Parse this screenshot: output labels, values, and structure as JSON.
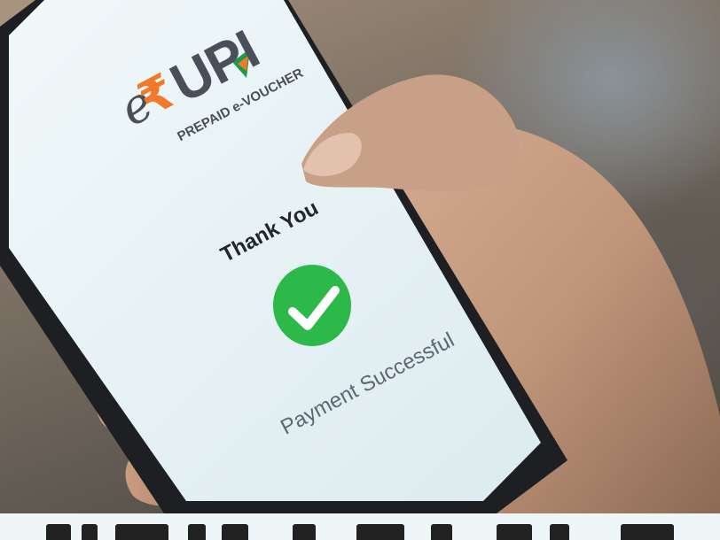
{
  "screen": {
    "logo_prefix": "e",
    "logo_rupee": "₹",
    "logo_main": "UPI",
    "logo_subtitle": "PREPAID e-VOUCHER",
    "heading": "Thank You",
    "status_message": "Payment Successful"
  },
  "colors": {
    "screen_bg": "#e9f4f6",
    "success_green": "#2db84a",
    "logo_orange": "#f07a2a",
    "logo_green": "#1a9a4b",
    "bottom_band": "#eef6f7"
  },
  "icons": {
    "success": "check-circle-icon"
  }
}
